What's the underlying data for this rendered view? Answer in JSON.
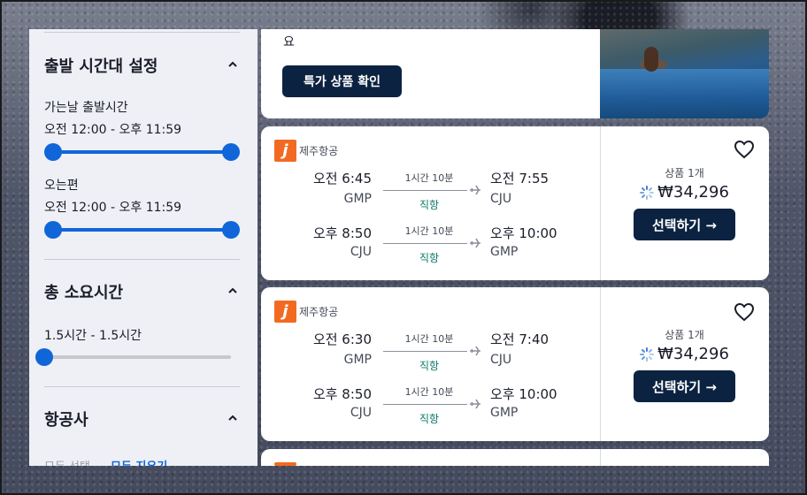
{
  "sidebar": {
    "departure_time": {
      "title": "출발 시간대 설정",
      "outbound_label": "가는날 출발시간",
      "outbound_range": "오전 12:00 - 오후 11:59",
      "inbound_label": "오는편",
      "inbound_range": "오전 12:00 - 오후 11:59"
    },
    "duration": {
      "title": "총 소요시간",
      "range": "1.5시간 - 1.5시간"
    },
    "airlines": {
      "title": "항공사",
      "select_all": "모두 선택",
      "clear_all": "모두 지우기"
    }
  },
  "promo": {
    "text": "요",
    "button": "특가 상품 확인"
  },
  "results": [
    {
      "airline": "제주항공",
      "logo_letter": "j",
      "outbound": {
        "dep_time": "오전 6:45",
        "dep_code": "GMP",
        "duration": "1시간 10분",
        "stops": "직항",
        "arr_time": "오전 7:55",
        "arr_code": "CJU"
      },
      "inbound": {
        "dep_time": "오후 8:50",
        "dep_code": "CJU",
        "duration": "1시간 10분",
        "stops": "직항",
        "arr_time": "오후 10:00",
        "arr_code": "GMP"
      },
      "deal_count": "상품 1개",
      "price": "₩34,296",
      "select_button": "선택하기 →"
    },
    {
      "airline": "제주항공",
      "logo_letter": "j",
      "outbound": {
        "dep_time": "오전 6:30",
        "dep_code": "GMP",
        "duration": "1시간 10분",
        "stops": "직항",
        "arr_time": "오전 7:40",
        "arr_code": "CJU"
      },
      "inbound": {
        "dep_time": "오후 8:50",
        "dep_code": "CJU",
        "duration": "1시간 10분",
        "stops": "직항",
        "arr_time": "오후 10:00",
        "arr_code": "GMP"
      },
      "deal_count": "상품 1개",
      "price": "₩34,296",
      "select_button": "선택하기 →"
    }
  ],
  "colors": {
    "accent": "#1066d8",
    "button_dark": "#0b2341",
    "airline_orange": "#f26a21",
    "direct_teal": "#0a7a6a"
  }
}
